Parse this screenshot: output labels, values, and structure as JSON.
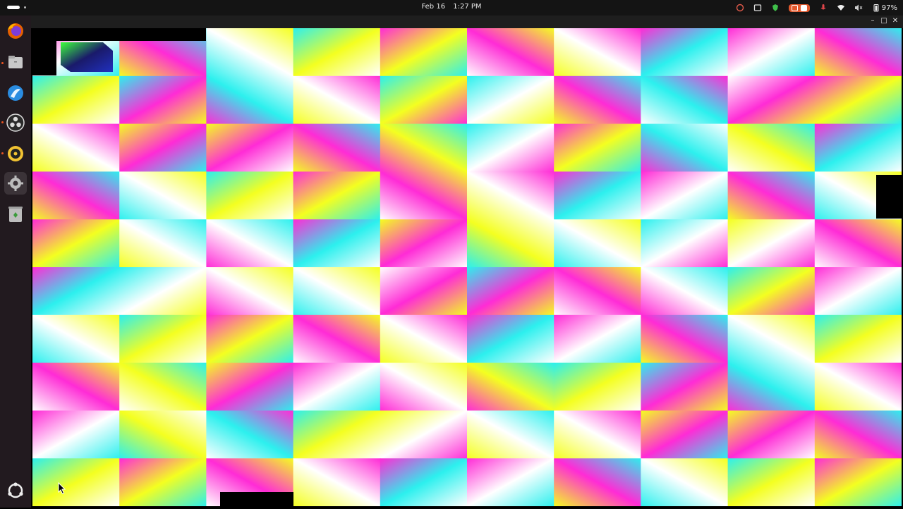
{
  "topbar": {
    "date": "Feb 16",
    "time": "1:27 PM",
    "battery": "97%"
  },
  "dock": {
    "items": [
      {
        "name": "firefox-icon"
      },
      {
        "name": "files-icon"
      },
      {
        "name": "software-icon"
      },
      {
        "name": "obs-icon"
      },
      {
        "name": "rhythmbox-icon"
      },
      {
        "name": "settings-icon"
      },
      {
        "name": "trash-icon"
      }
    ],
    "bottom": {
      "name": "show-apps-icon"
    }
  },
  "colors": {
    "magenta": "#ff2bd6",
    "cyan": "#2cf0ee",
    "yellow": "#f4ff20",
    "white": "#ffffff",
    "dock_bg": "#221a1f",
    "accent": "#e95420"
  },
  "canvas": {
    "columns": 10,
    "rows": 10
  }
}
